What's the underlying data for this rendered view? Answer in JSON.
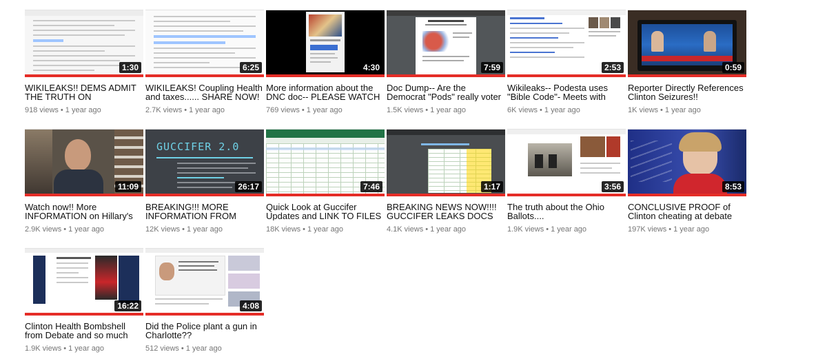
{
  "videos": [
    {
      "title": "WIKILEAKS!! DEMS ADMIT THE TRUTH ON ECONOMY!!",
      "duration": "1:30",
      "views": "918 views",
      "age": "1 year ago",
      "progress": 1.0
    },
    {
      "title": "WIKILEAKS! Coupling Health and taxes...... SHARE NOW!",
      "duration": "6:25",
      "views": "2.7K views",
      "age": "1 year ago",
      "progress": 1.0
    },
    {
      "title": "More information about the DNC doc-- PLEASE WATCH",
      "duration": "4:30",
      "views": "769 views",
      "age": "1 year ago",
      "progress": 1.0
    },
    {
      "title": "Doc Dump-- Are the Democrat \"Pods\" really voter",
      "duration": "7:59",
      "views": "1.5K views",
      "age": "1 year ago",
      "progress": 1.0
    },
    {
      "title": "Wikileaks-- Podesta uses \"Bible Code\"- Meets with",
      "duration": "2:53",
      "views": "6K views",
      "age": "1 year ago",
      "progress": 1.0
    },
    {
      "title": "Reporter Directly References Clinton Seizures!!",
      "duration": "0:59",
      "views": "1K views",
      "age": "1 year ago",
      "progress": 1.0
    },
    {
      "title": "Watch now!! More INFORMATION on Hillary's",
      "duration": "11:09",
      "views": "2.9K views",
      "age": "1 year ago",
      "progress": 1.0
    },
    {
      "title": "BREAKING!!! MORE INFORMATION FROM",
      "duration": "26:17",
      "views": "12K views",
      "age": "1 year ago",
      "progress": 1.0,
      "thumb_text": "GUCCIFER 2.0"
    },
    {
      "title": "Quick Look at Guccifer Updates and LINK TO FILES",
      "duration": "7:46",
      "views": "18K views",
      "age": "1 year ago",
      "progress": 1.0
    },
    {
      "title": "BREAKING NEWS NOW!!!! GUCCIFER LEAKS DOCS ON",
      "duration": "1:17",
      "views": "4.1K views",
      "age": "1 year ago",
      "progress": 1.0
    },
    {
      "title": "The truth about the Ohio Ballots....",
      "duration": "3:56",
      "views": "1.9K views",
      "age": "1 year ago",
      "progress": 1.0
    },
    {
      "title": "CONCLUSIVE PROOF of Clinton cheating at debate",
      "duration": "8:53",
      "views": "197K views",
      "age": "1 year ago",
      "progress": 1.0
    },
    {
      "title": "Clinton Health Bombshell from Debate and so much",
      "duration": "16:22",
      "views": "1.9K views",
      "age": "1 year ago",
      "progress": 1.0
    },
    {
      "title": "Did the Police plant a gun in Charlotte??",
      "duration": "4:08",
      "views": "512 views",
      "age": "1 year ago",
      "progress": 1.0
    }
  ],
  "colors": {
    "progress_watched": "#e52d27",
    "title_text": "#111111",
    "meta_text": "#767676",
    "duration_bg": "#000000"
  },
  "icons": {
    "separator": "bullet-dot"
  }
}
